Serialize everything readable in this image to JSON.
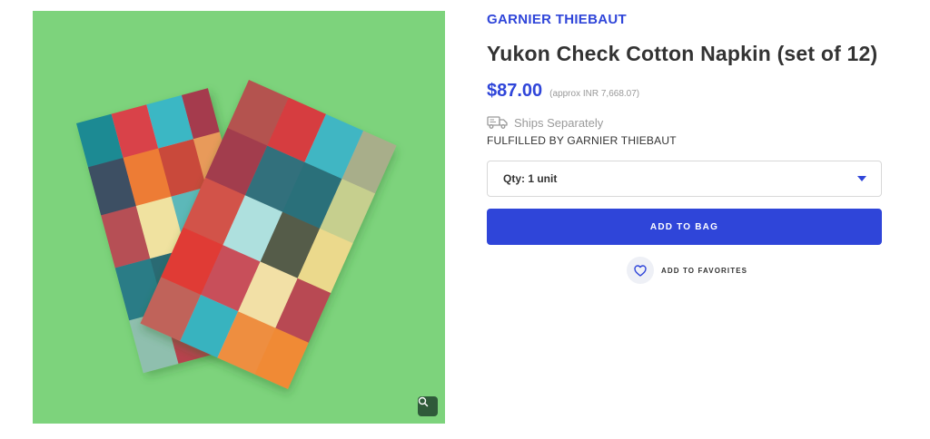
{
  "product": {
    "brand": "GARNIER THIEBAUT",
    "title": "Yukon Check Cotton Napkin (set of 12)",
    "price": "$87.00",
    "approx_price": "(approx INR 7,668.07)",
    "shipping_note": "Ships Separately",
    "fulfilled_by": "FULFILLED BY GARNIER THIEBAUT"
  },
  "quantity": {
    "selected_label": "Qty: 1 unit"
  },
  "actions": {
    "add_to_bag_label": "ADD TO BAG",
    "add_to_favorites_label": "ADD TO FAVORITES"
  },
  "image": {
    "alt": "Yukon Check Cotton Napkin",
    "background_color": "#7dd37c",
    "zoom_icon": "search-icon"
  },
  "colors": {
    "accent": "#2f45d9",
    "text_primary": "#333333",
    "text_muted": "#999999"
  }
}
